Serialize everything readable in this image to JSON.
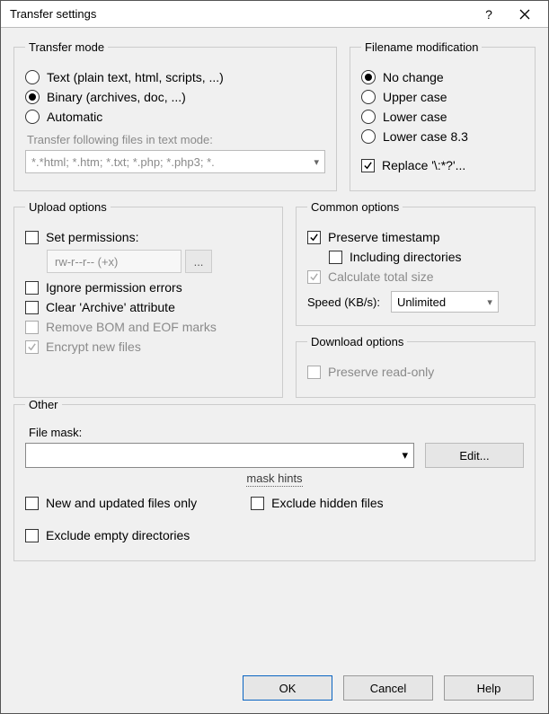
{
  "title": "Transfer settings",
  "groups": {
    "transfer_mode": "Transfer mode",
    "filename_mod": "Filename modification",
    "upload_options": "Upload options",
    "common_options": "Common options",
    "download_options": "Download options",
    "other": "Other"
  },
  "transfer_mode": {
    "text": "Text (plain text, html, scripts, ...)",
    "binary": "Binary (archives, doc, ...)",
    "automatic": "Automatic",
    "hint": "Transfer following files in text mode:",
    "patterns": "*.*html; *.htm; *.txt; *.php; *.php3; *."
  },
  "filename_mod": {
    "no_change": "No change",
    "upper": "Upper case",
    "lower": "Lower case",
    "lower83": "Lower case 8.3",
    "replace": "Replace '\\:*?'..."
  },
  "upload": {
    "set_permissions": "Set permissions:",
    "perm_value": "rw-r--r-- (+x)",
    "perm_btn": "...",
    "ignore_perm_errors": "Ignore permission errors",
    "clear_archive": "Clear 'Archive' attribute",
    "remove_bom": "Remove BOM and EOF marks",
    "encrypt": "Encrypt new files"
  },
  "common": {
    "preserve_timestamp": "Preserve timestamp",
    "including_dirs": "Including directories",
    "calc_total": "Calculate total size",
    "speed_label": "Speed (KB/s):",
    "speed_value": "Unlimited"
  },
  "download": {
    "preserve_readonly": "Preserve read-only"
  },
  "other": {
    "file_mask_label": "File mask:",
    "edit": "Edit...",
    "mask_hints": "mask hints",
    "new_updated": "New and updated files only",
    "exclude_hidden": "Exclude hidden files",
    "exclude_empty": "Exclude empty directories"
  },
  "footer": {
    "ok": "OK",
    "cancel": "Cancel",
    "help": "Help"
  }
}
